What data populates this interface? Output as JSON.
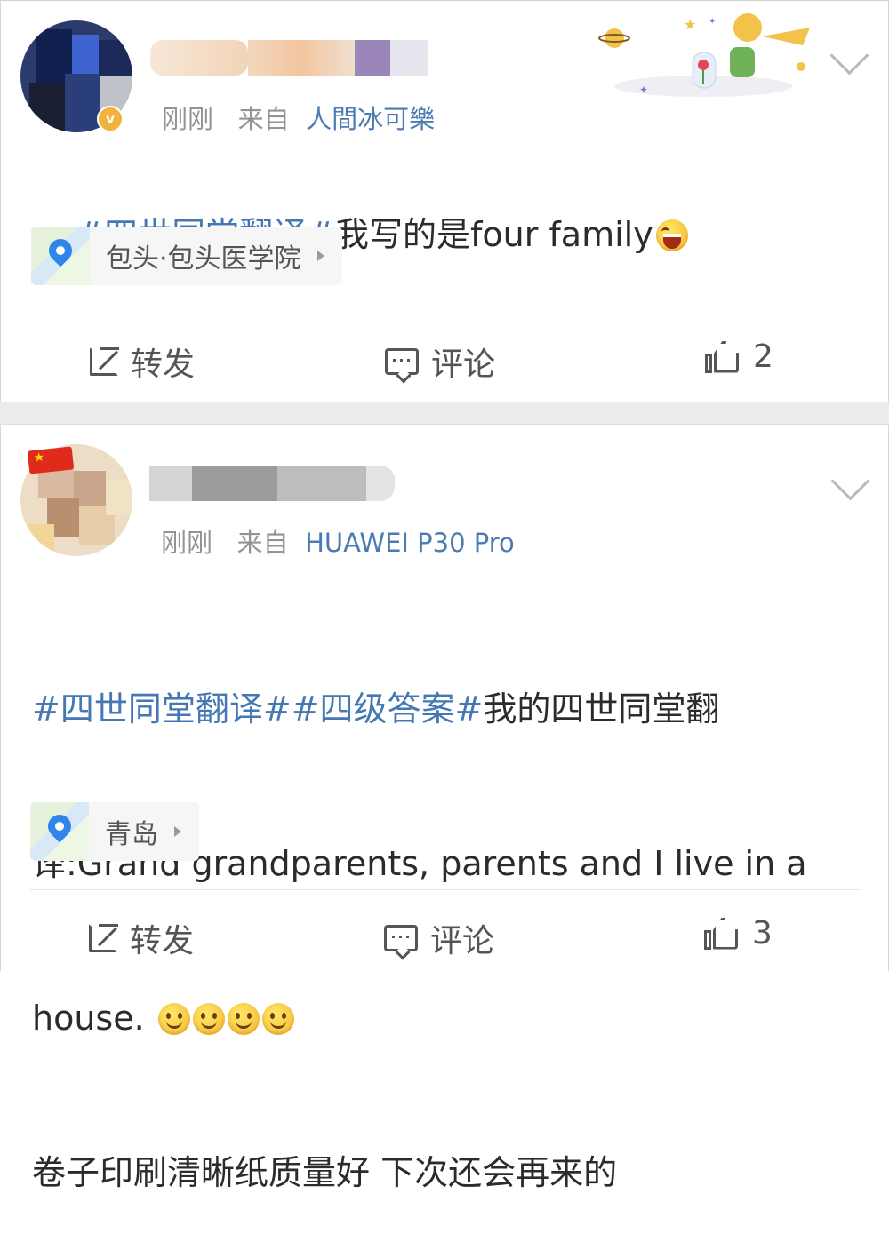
{
  "posts": [
    {
      "meta_time": "刚刚",
      "meta_from": "来自",
      "meta_source": "人間冰可樂",
      "text_tag": "#四世同堂翻译#",
      "text_body": "我写的是four family",
      "location": "包头·包头医学院",
      "actions": {
        "repost": "转发",
        "comment": "评论",
        "like_count": "2"
      }
    },
    {
      "meta_time": "刚刚",
      "meta_from": "来自",
      "meta_source": "HUAWEI P30 Pro",
      "text_tag1": "#四世同堂翻译#",
      "text_tag2": "#四级答案#",
      "text_line1": "我的四世同堂翻",
      "text_line2": "译:Grand grandparents, parents and I live in a",
      "text_line3": "house. ",
      "text_line4": "卷子印刷清晰纸质量好 下次还会再来的",
      "location": "青岛",
      "actions": {
        "repost": "转发",
        "comment": "评论",
        "like_count": "3"
      }
    }
  ],
  "colors": {
    "link": "#4477b4",
    "source": "#4c7bb2",
    "meta": "#939393",
    "text": "#2b2b2b",
    "pin": "#2f86e8"
  }
}
